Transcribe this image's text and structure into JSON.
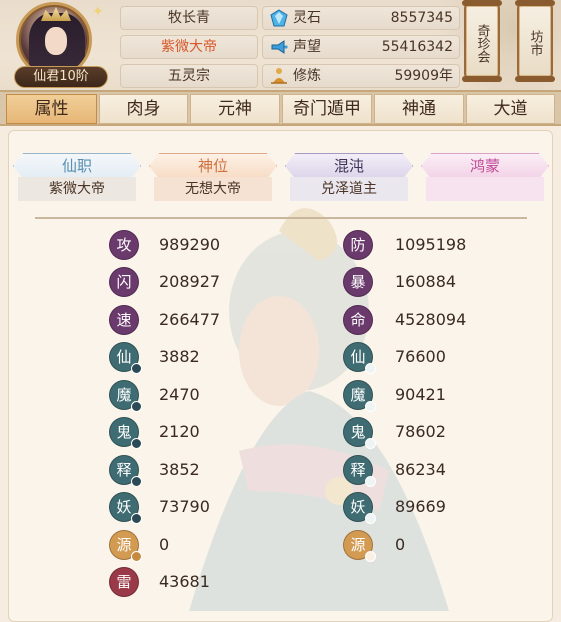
{
  "player": {
    "name": "牧长青",
    "title": "紫微大帝",
    "sect": "五灵宗",
    "rank": "仙君10阶"
  },
  "resources": [
    {
      "icon": "spirit-stone-icon",
      "label": "灵石",
      "value": "8557345"
    },
    {
      "icon": "reputation-icon",
      "label": "声望",
      "value": "55416342"
    },
    {
      "icon": "cultivation-icon",
      "label": "修炼",
      "value": "59909年"
    }
  ],
  "side_buttons": [
    {
      "label": "奇珍会"
    },
    {
      "label": "坊市"
    }
  ],
  "tabs": [
    {
      "label": "属性",
      "active": true
    },
    {
      "label": "肉身",
      "active": false
    },
    {
      "label": "元神",
      "active": false
    },
    {
      "label": "奇门遁甲",
      "active": false
    },
    {
      "label": "神通",
      "active": false
    },
    {
      "label": "大道",
      "active": false
    }
  ],
  "positions": [
    {
      "label": "仙职",
      "value": "紫微大帝",
      "color": "#5a8fb0"
    },
    {
      "label": "神位",
      "value": "无想大帝",
      "color": "#d0703f"
    },
    {
      "label": "混沌",
      "value": "兑泽道主",
      "color": "#5b4a7a"
    },
    {
      "label": "鸿蒙",
      "value": "",
      "color": "#c04a96"
    }
  ],
  "stats_left": [
    {
      "glyph": "攻",
      "value": "989290",
      "style": "purple",
      "pip": ""
    },
    {
      "glyph": "闪",
      "value": "208927",
      "style": "purple",
      "pip": ""
    },
    {
      "glyph": "速",
      "value": "266477",
      "style": "purple",
      "pip": ""
    },
    {
      "glyph": "仙",
      "value": "3882",
      "style": "teal",
      "pip": "dark"
    },
    {
      "glyph": "魔",
      "value": "2470",
      "style": "teal",
      "pip": "dark"
    },
    {
      "glyph": "鬼",
      "value": "2120",
      "style": "teal",
      "pip": "dark"
    },
    {
      "glyph": "释",
      "value": "3852",
      "style": "teal",
      "pip": "dark"
    },
    {
      "glyph": "妖",
      "value": "73790",
      "style": "teal",
      "pip": "dark"
    },
    {
      "glyph": "源",
      "value": "0",
      "style": "orange",
      "pip": "orange"
    },
    {
      "glyph": "雷",
      "value": "43681",
      "style": "crimson",
      "pip": ""
    }
  ],
  "stats_right": [
    {
      "glyph": "防",
      "value": "1095198",
      "style": "purple",
      "pip": ""
    },
    {
      "glyph": "暴",
      "value": "160884",
      "style": "purple",
      "pip": ""
    },
    {
      "glyph": "命",
      "value": "4528094",
      "style": "purple",
      "pip": ""
    },
    {
      "glyph": "仙",
      "value": "76600",
      "style": "teal",
      "pip": "light"
    },
    {
      "glyph": "魔",
      "value": "90421",
      "style": "teal",
      "pip": "light"
    },
    {
      "glyph": "鬼",
      "value": "78602",
      "style": "teal",
      "pip": "light"
    },
    {
      "glyph": "释",
      "value": "86234",
      "style": "teal",
      "pip": "light"
    },
    {
      "glyph": "妖",
      "value": "89669",
      "style": "teal",
      "pip": "light"
    },
    {
      "glyph": "源",
      "value": "0",
      "style": "orange",
      "pip": "light"
    }
  ],
  "colors": {
    "purple": "#6b3a6d",
    "teal": "#3f6c72",
    "orange": "#d39a52",
    "crimson": "#9a3a48",
    "accent_title": "#d8582a"
  }
}
